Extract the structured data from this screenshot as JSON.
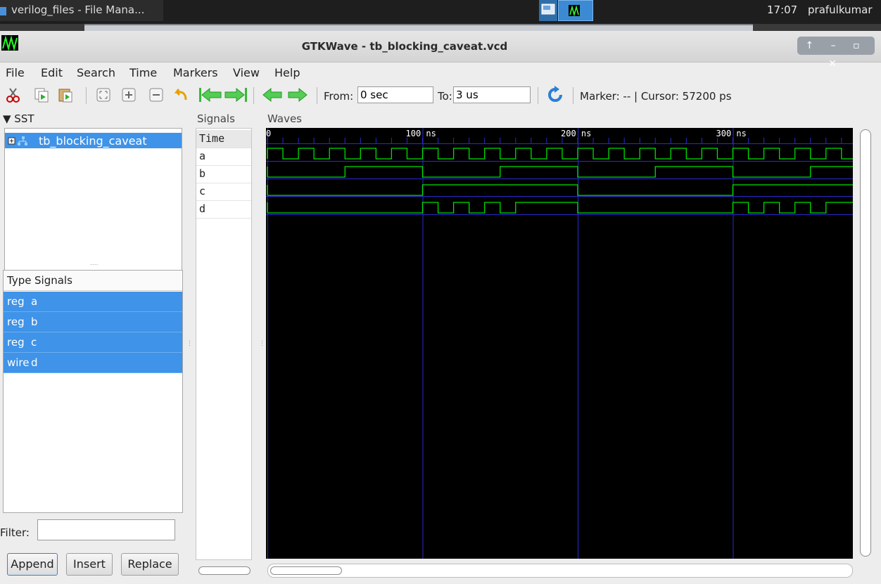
{
  "taskbar": {
    "task_label": "verilog_files - File Mana...",
    "clock": "17:07",
    "user": "prafulkumar"
  },
  "window": {
    "title": "GTKWave - tb_blocking_caveat.vcd",
    "controls": "↑ – ▫ ✕"
  },
  "menu": [
    "File",
    "Edit",
    "Search",
    "Time",
    "Markers",
    "View",
    "Help"
  ],
  "toolbar": {
    "from_label": "From:",
    "from_value": "0 sec",
    "to_label": "To:",
    "to_value": "3 us",
    "marker_text": "Marker: --  |  Cursor: 57200 ps",
    "icons": [
      "cut-icon",
      "copy-icon",
      "paste-icon",
      "zoom-fit-icon",
      "zoom-in-icon",
      "zoom-out-icon",
      "undo-zoom-icon",
      "zoom-start-icon",
      "zoom-end-icon",
      "prev-edge-icon",
      "next-edge-icon",
      "reload-icon"
    ]
  },
  "sst": {
    "header": "▼ SST",
    "tree_item": "tb_blocking_caveat"
  },
  "signal_list": {
    "col_type": "Type",
    "col_signals": "Signals",
    "rows": [
      {
        "type": "reg",
        "name": "a"
      },
      {
        "type": "reg",
        "name": "b"
      },
      {
        "type": "reg",
        "name": "c"
      },
      {
        "type": "wire",
        "name": "d"
      }
    ]
  },
  "filter": {
    "label": "Filter:",
    "value": ""
  },
  "buttons": {
    "append": "Append",
    "insert": "Insert",
    "replace": "Replace"
  },
  "signals_pane": {
    "header": "Signals",
    "rows": [
      "Time",
      "a",
      "b",
      "c",
      "d"
    ]
  },
  "waves": {
    "header": "Waves",
    "time_labels": [
      "0",
      "100 ns",
      "200 ns",
      "300 ns"
    ],
    "colors": {
      "background": "#000000",
      "trace": "#00e000",
      "grid": "#2a2ad0",
      "label": "#ffffff"
    },
    "traces": {
      "a": {
        "period_ns": 20,
        "start_high_ns": 0
      },
      "b": {
        "high_intervals_ns": [
          [
            50,
            100
          ],
          [
            150,
            200
          ],
          [
            250,
            300
          ],
          [
            350,
            380
          ]
        ]
      },
      "c": {
        "high_intervals_ns": [
          [
            100,
            200
          ],
          [
            300,
            380
          ]
        ]
      },
      "d": {
        "high_intervals_ns": [
          [
            100,
            110
          ],
          [
            120,
            130
          ],
          [
            140,
            150
          ],
          [
            160,
            200
          ],
          [
            300,
            310
          ],
          [
            320,
            330
          ],
          [
            340,
            350
          ],
          [
            360,
            380
          ]
        ]
      }
    }
  }
}
